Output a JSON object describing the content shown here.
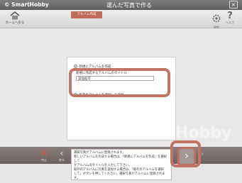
{
  "titlebar": {
    "app_name": "© SmartHobby",
    "window_title": "選んだ写真で作る",
    "close_label": "×"
  },
  "toolbar": {
    "home_label": "ホームへ戻る",
    "breadcrumb": "アルバム作成",
    "settings_label": "設定",
    "help_label": "ヘルプ",
    "help_glyph": "?"
  },
  "dialog": {
    "option_new": "新規にアルバムを作成",
    "title_label": "新規に作成するアルバムのタイトル",
    "album_title_value": "菜仙仙写",
    "option_existing": "既存のアルバムを選択して追加"
  },
  "watermark": "SmartHobby",
  "footer": {
    "cancel_glyph": "✕",
    "cancel_label": "中止",
    "back_glyph": "‹",
    "back_label": "戻る",
    "message_lines": [
      "選択写真がアルバムに登録されます。",
      "新しいアルバムを作成する場合は、「新規にアルバムを作成」を選択して",
      "かアルバムのタイトルを入力して下さい。",
      "既存のアルバムに写真を追加する場合は、「既存のアルバムを選択",
      "して」ボタンを押してください。選択写真がアルバムに登録されます。"
    ],
    "next_glyph": "›",
    "forward_glyph": "›"
  },
  "colors": {
    "accent": "#c06a58",
    "highlight_border": "#c37363"
  }
}
